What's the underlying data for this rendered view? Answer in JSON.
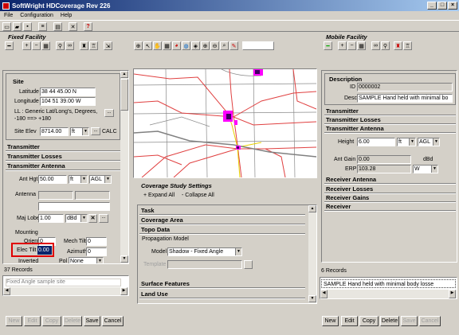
{
  "window": {
    "title": "SoftWright HDCoverage Rev 226"
  },
  "menu": [
    "File",
    "Configuration",
    "Help"
  ],
  "fixed_facility": {
    "header": "Fixed Facility",
    "site": {
      "heading": "Site",
      "latitude_label": "Latitude",
      "latitude": "38 44 45.00 N",
      "longitude_label": "Longitude",
      "longitude": "104 51 39.00 W",
      "ll_note": "LL : Generic Lat/Long's, Degrees, -180 ==> +180",
      "elev_label": "Site Elev",
      "elev": "8714.00",
      "elev_unit": "ft",
      "calc_label": "CALC"
    },
    "transmitter": "Transmitter",
    "transmitter_losses": "Transmitter Losses",
    "transmitter_antenna": {
      "heading": "Transmitter Antenna",
      "ant_hgt_label": "Ant Hgt",
      "ant_hgt": "50.00",
      "ant_hgt_unit": "ft",
      "ant_hgt_ref": "AGL",
      "antenna_label": "Antenna",
      "maj_lobe_label": "Maj Lobe",
      "maj_lobe": "1.00",
      "maj_lobe_unit": "dBd",
      "mounting_label": "Mounting",
      "orient_label": "Orient",
      "orient": "0",
      "mech_tilt_label": "Mech Tilt",
      "mech_tilt": "0",
      "elec_tilt_label": "Elec Tilt",
      "elec_tilt": "0.00",
      "azimuth_label": "Azimuth",
      "azimuth": "0",
      "inverted_label": "Inverted",
      "pol_label": "Pol",
      "pol": "None"
    },
    "records": "37 Records",
    "selected_record": "Fixed Angle sample site",
    "buttons": [
      "New",
      "Edit",
      "Copy",
      "Delete",
      "Save",
      "Cancel"
    ]
  },
  "coverage": {
    "header": "Coverage Study Settings",
    "expand_all": "+ Expand All",
    "collapse_all": "- Collapse All",
    "sections": {
      "task": "Task",
      "coverage_area": "Coverage Area",
      "topo_data": "Topo Data",
      "surface_features": "Surface Features",
      "land_use": "Land Use"
    },
    "propagation_model": {
      "heading": "Propagation Model",
      "model_label": "Model",
      "model": "Shadow - Fixed Angle",
      "template_label": "Template"
    }
  },
  "mobile_facility": {
    "header": "Mobile Facility",
    "description": {
      "heading": "Description",
      "id_label": "ID",
      "id": "0000002",
      "desc_label": "Desc",
      "desc": "SAMPLE Hand held with minimal bo"
    },
    "transmitter": "Transmitter",
    "transmitter_losses": "Transmitter Losses",
    "transmitter_antenna": {
      "heading": "Transmitter Antenna",
      "height_label": "Height",
      "height": "6.00",
      "height_unit": "ft",
      "height_ref": "AGL",
      "ant_gain_label": "Ant Gain",
      "ant_gain": "0.00",
      "ant_gain_unit": "dBd",
      "erp_label": "ERP",
      "erp": "103.28",
      "erp_unit": "W"
    },
    "receiver_antenna": "Receiver Antenna",
    "receiver_losses": "Receiver Losses",
    "receiver_gains": "Receiver Gains",
    "receiver": "Receiver",
    "records": "6 Records",
    "selected_record": "SAMPLE Hand held with minimal body losse",
    "buttons": [
      "New",
      "Edit",
      "Copy",
      "Delete",
      "Save",
      "Cancel"
    ]
  },
  "colors": {
    "title_start": "#0a246a",
    "title_end": "#a6caf0",
    "highlight": "#e00000",
    "selection": "#0a246a"
  }
}
